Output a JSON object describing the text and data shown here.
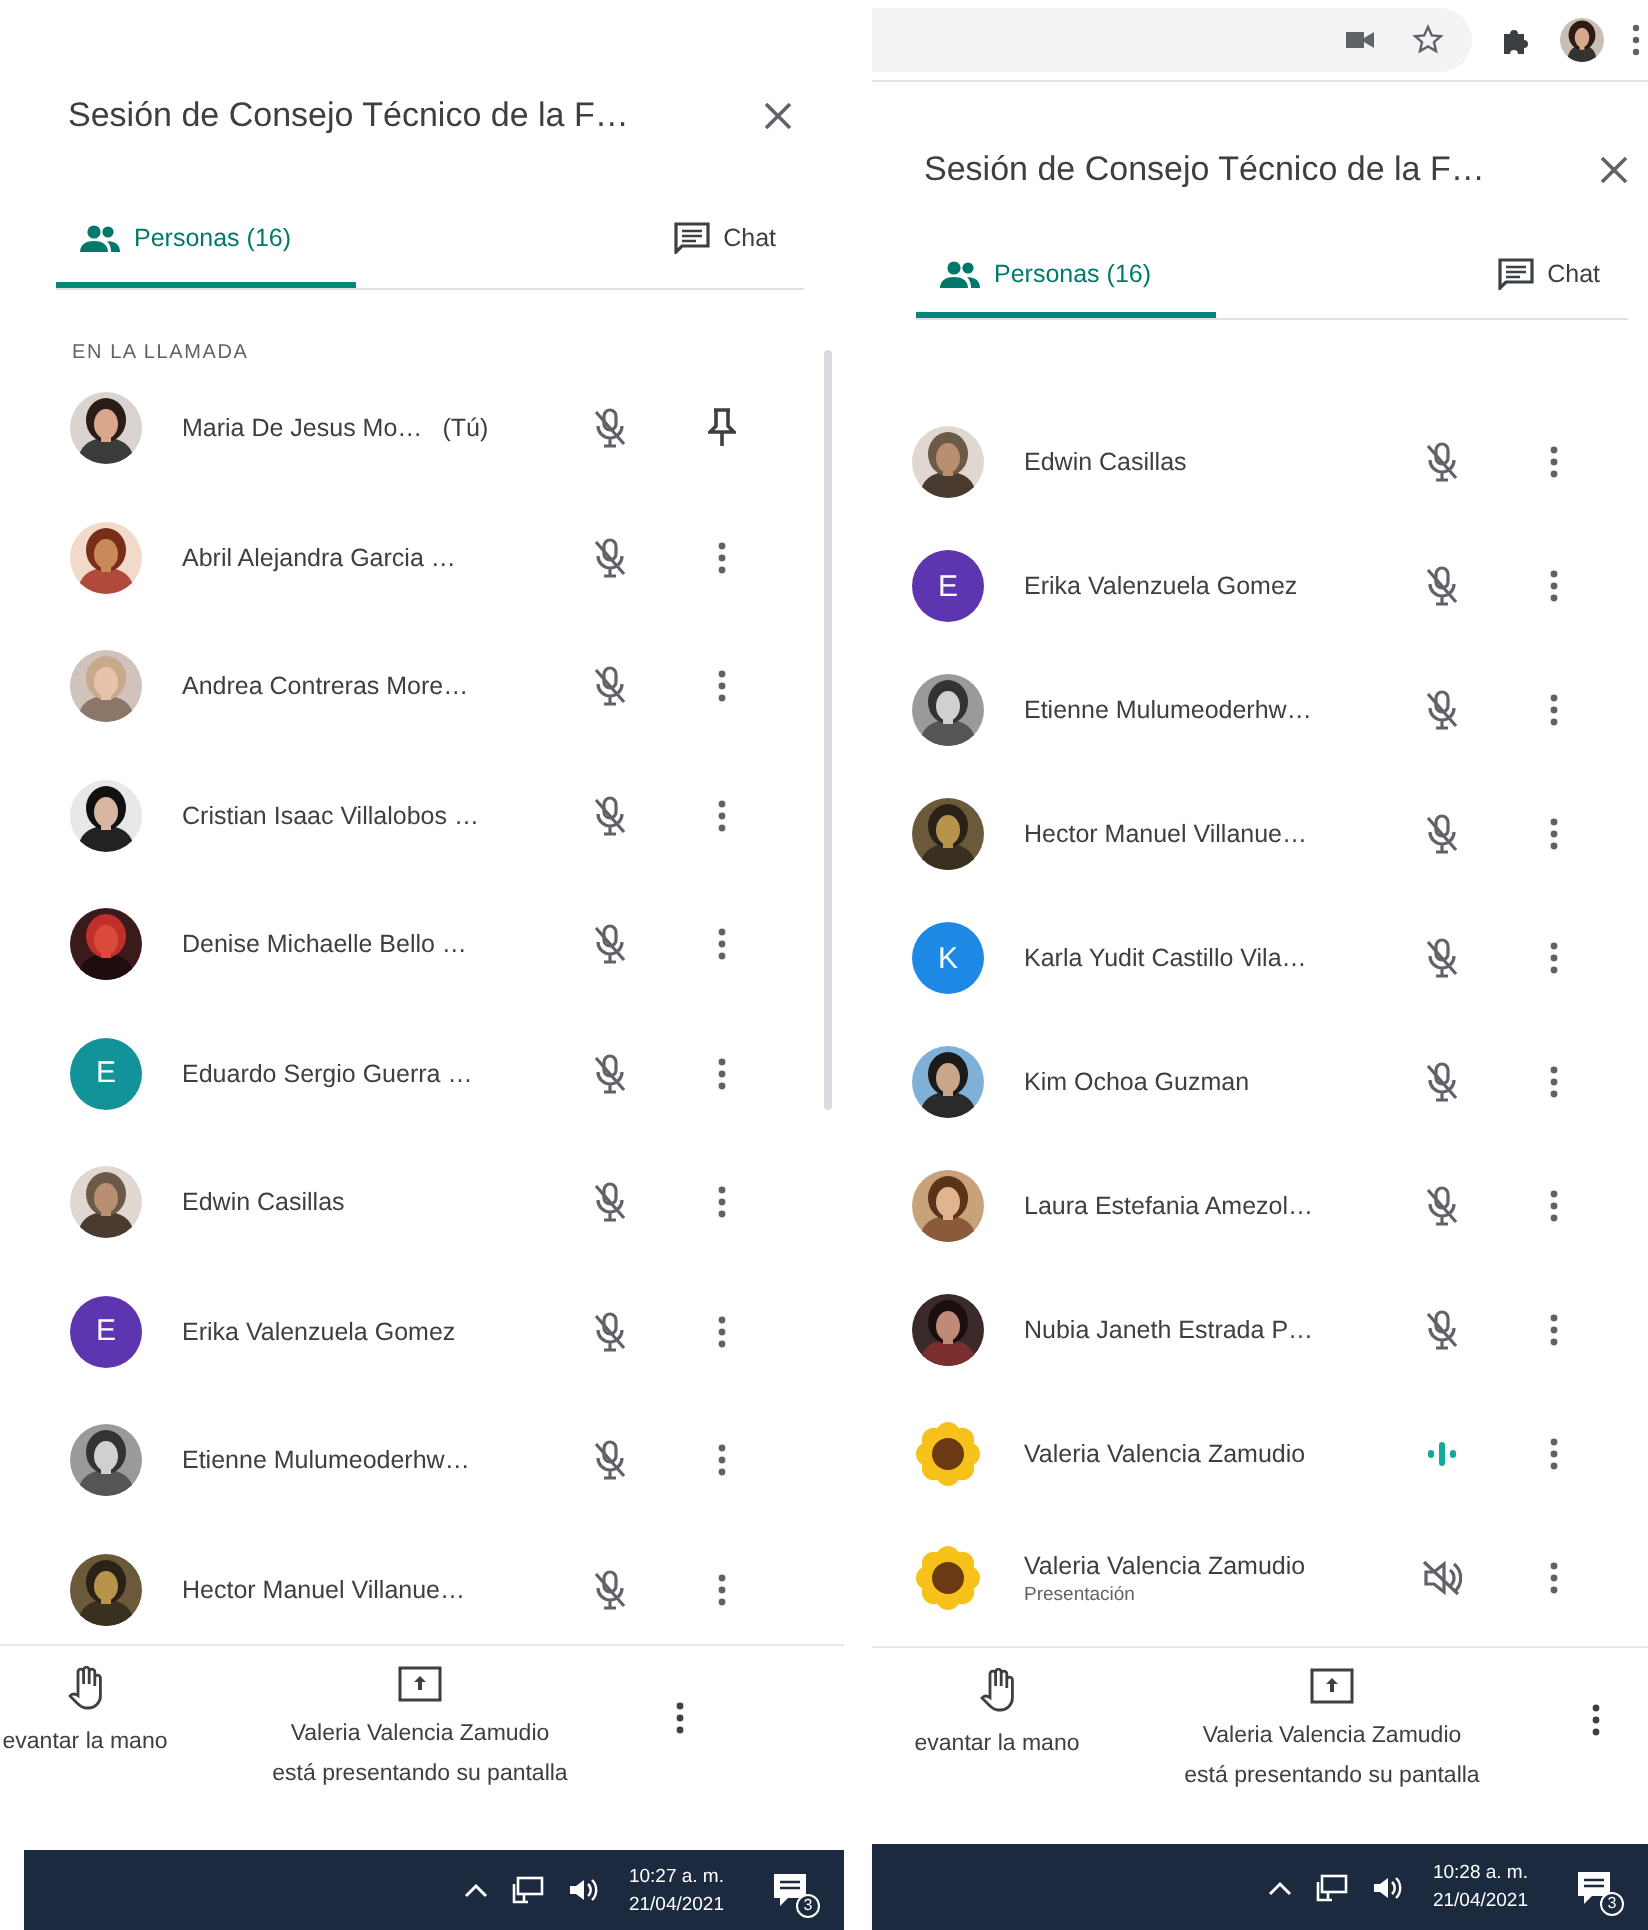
{
  "panels": [
    {
      "browser_toolbar": false,
      "scrollbar_visible": true,
      "title": "Sesión de Consejo Técnico de la F…",
      "tabs": [
        {
          "label": "Personas (16)",
          "selected": true,
          "kind": "people"
        },
        {
          "label": "Chat",
          "selected": false,
          "kind": "chat"
        }
      ],
      "section_label": "EN LA LLAMADA",
      "participants": [
        {
          "name": "Maria De Jesus Mo…",
          "you_label": "(Tú)",
          "audio": {
            "kind": "muted"
          },
          "action": {
            "kind": "pin"
          }
        },
        {
          "name": "Abril Alejandra Garcia …",
          "audio": {
            "kind": "muted"
          },
          "action": {
            "kind": "more"
          }
        },
        {
          "name": "Andrea Contreras More…",
          "audio": {
            "kind": "muted"
          },
          "action": {
            "kind": "more"
          }
        },
        {
          "name": "Cristian Isaac Villalobos …",
          "audio": {
            "kind": "muted"
          },
          "action": {
            "kind": "more"
          }
        },
        {
          "name": "Denise Michaelle Bello …",
          "audio": {
            "kind": "muted"
          },
          "action": {
            "kind": "more"
          }
        },
        {
          "name": "Eduardo Sergio Guerra …",
          "avatar": {
            "kind": "letter",
            "letter": "E",
            "color": "#12939a"
          },
          "audio": {
            "kind": "muted"
          },
          "action": {
            "kind": "more"
          }
        },
        {
          "name": "Edwin Casillas",
          "audio": {
            "kind": "muted"
          },
          "action": {
            "kind": "more"
          }
        },
        {
          "name": "Erika Valenzuela Gomez",
          "avatar": {
            "kind": "letter",
            "letter": "E",
            "color": "#5e35b1"
          },
          "audio": {
            "kind": "muted"
          },
          "action": {
            "kind": "more"
          }
        },
        {
          "name": "Etienne Mulumeoderhw…",
          "audio": {
            "kind": "muted"
          },
          "action": {
            "kind": "more"
          }
        },
        {
          "name": "Hector Manuel Villanue…",
          "audio": {
            "kind": "muted"
          },
          "action": {
            "kind": "more"
          }
        }
      ],
      "footer": {
        "raise_hand": "evantar la mano",
        "presenting": "Valeria Valencia Zamudio\nestá presentando su pantalla"
      },
      "taskbar": {
        "time": "10:27 a. m.",
        "date": "21/04/2021",
        "notifications": "3"
      }
    },
    {
      "browser_toolbar": true,
      "scrollbar_visible": false,
      "title": "Sesión de Consejo Técnico de la F…",
      "tabs": [
        {
          "label": "Personas (16)",
          "selected": true,
          "kind": "people"
        },
        {
          "label": "Chat",
          "selected": false,
          "kind": "chat"
        }
      ],
      "participants": [
        {
          "name": "Edwin Casillas",
          "audio": {
            "kind": "muted"
          },
          "action": {
            "kind": "more"
          }
        },
        {
          "name": "Erika Valenzuela Gomez",
          "avatar": {
            "kind": "letter",
            "letter": "E",
            "color": "#5e35b1"
          },
          "audio": {
            "kind": "muted"
          },
          "action": {
            "kind": "more"
          }
        },
        {
          "name": "Etienne Mulumeoderhw…",
          "audio": {
            "kind": "muted"
          },
          "action": {
            "kind": "more"
          }
        },
        {
          "name": "Hector Manuel Villanue…",
          "audio": {
            "kind": "muted"
          },
          "action": {
            "kind": "more"
          }
        },
        {
          "name": "Karla Yudit Castillo Vila…",
          "avatar": {
            "kind": "letter",
            "letter": "K",
            "color": "#1e88e5"
          },
          "audio": {
            "kind": "muted"
          },
          "action": {
            "kind": "more"
          }
        },
        {
          "name": "Kim Ochoa Guzman",
          "audio": {
            "kind": "muted"
          },
          "action": {
            "kind": "more"
          }
        },
        {
          "name": "Laura Estefania Amezol…",
          "audio": {
            "kind": "muted"
          },
          "action": {
            "kind": "more"
          }
        },
        {
          "name": "Nubia Janeth Estrada P…",
          "audio": {
            "kind": "muted"
          },
          "action": {
            "kind": "more"
          }
        },
        {
          "name": "Valeria Valencia Zamudio",
          "audio": {
            "kind": "speaking"
          },
          "action": {
            "kind": "more"
          }
        },
        {
          "name": "Valeria Valencia Zamudio",
          "subtitle": "Presentación",
          "audio": {
            "kind": "presentation"
          },
          "action": {
            "kind": "more"
          }
        }
      ],
      "footer": {
        "raise_hand": "evantar la mano",
        "presenting": "Valeria Valencia Zamudio\nestá presentando su pantalla"
      },
      "taskbar": {
        "time": "10:28 a. m.",
        "date": "21/04/2021",
        "notifications": "3"
      }
    }
  ]
}
